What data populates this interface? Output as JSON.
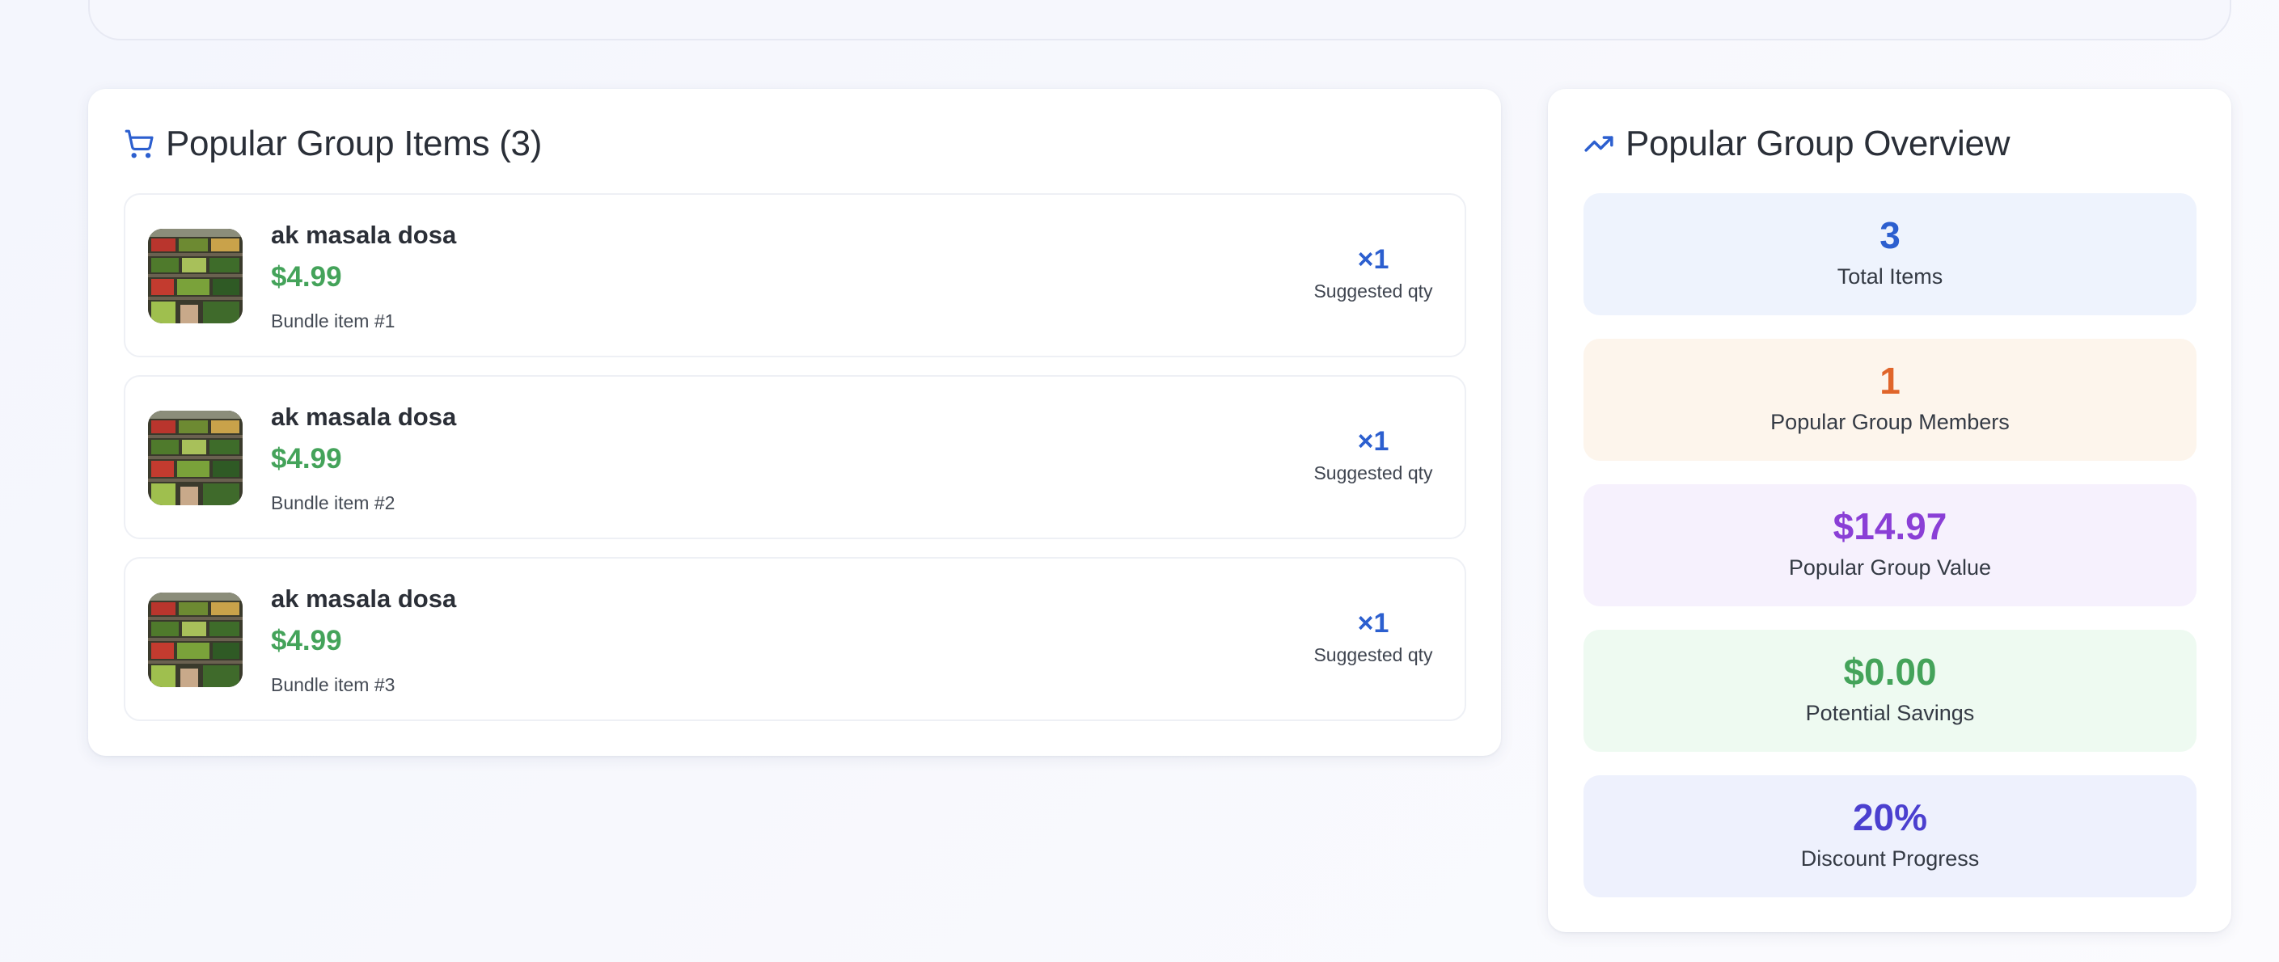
{
  "items_panel": {
    "title": "Popular Group Items (3)",
    "icon": "cart-icon",
    "accent": "#2c5fcf",
    "items": [
      {
        "name": "ak masala dosa",
        "price": "$4.99",
        "bundle_label": "Bundle item #1",
        "qty": "×1",
        "qty_label": "Suggested qty"
      },
      {
        "name": "ak masala dosa",
        "price": "$4.99",
        "bundle_label": "Bundle item #2",
        "qty": "×1",
        "qty_label": "Suggested qty"
      },
      {
        "name": "ak masala dosa",
        "price": "$4.99",
        "bundle_label": "Bundle item #3",
        "qty": "×1",
        "qty_label": "Suggested qty"
      }
    ]
  },
  "overview_panel": {
    "title": "Popular Group Overview",
    "icon": "trending-up-icon",
    "stats": [
      {
        "value": "3",
        "label": "Total Items",
        "value_color": "#2c5fcf",
        "bg": "#eef3fd"
      },
      {
        "value": "1",
        "label": "Popular Group Members",
        "value_color": "#e0652a",
        "bg": "#fdf5ec"
      },
      {
        "value": "$14.97",
        "label": "Popular Group Value",
        "value_color": "#8a3fd6",
        "bg": "#f6f1fd"
      },
      {
        "value": "$0.00",
        "label": "Potential Savings",
        "value_color": "#44a35a",
        "bg": "#eefaf1"
      },
      {
        "value": "20%",
        "label": "Discount Progress",
        "value_color": "#4b40cf",
        "bg": "#eef1fd"
      }
    ]
  }
}
